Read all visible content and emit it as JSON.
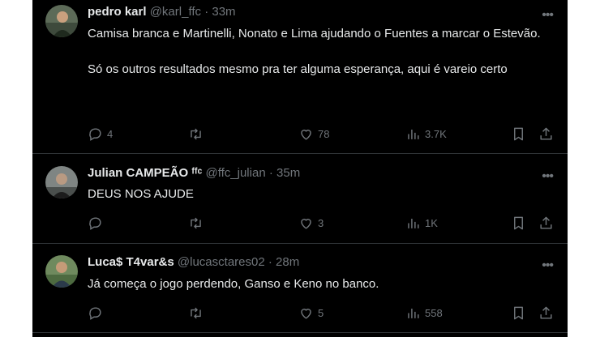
{
  "tweets": [
    {
      "name": "pedro karl",
      "handle": "@karl_ffc",
      "dot": "·",
      "time": "33m",
      "text": "Camisa branca e Martinelli, Nonato e Lima ajudando o Fuentes a marcar o Estevão.\n\nSó os outros resultados mesmo pra ter alguma esperança, aqui é vareio certo",
      "replies": "4",
      "retweets": "",
      "likes": "78",
      "views": "3.7K"
    },
    {
      "name": "Julian CAMPEÃO ᶠᶠᶜ",
      "handle": "@ffc_julian",
      "dot": "·",
      "time": "35m",
      "text": "DEUS NOS AJUDE",
      "replies": "",
      "retweets": "",
      "likes": "3",
      "views": "1K"
    },
    {
      "name": "Luca$ T4var&s",
      "handle": "@lucasctares02",
      "dot": "·",
      "time": "28m",
      "text": "Já começa o jogo perdendo, Ganso e Keno no banco.",
      "replies": "",
      "retweets": "",
      "likes": "5",
      "views": "558"
    }
  ],
  "icons": {
    "more": "more-icon",
    "reply": "reply-icon",
    "retweet": "retweet-icon",
    "like": "heart-icon",
    "views": "views-icon",
    "bookmark": "bookmark-icon",
    "share": "share-icon"
  },
  "colors": {
    "background": "#000000",
    "text": "#e7e9ea",
    "muted": "#71767b",
    "divider": "#2f3336"
  }
}
